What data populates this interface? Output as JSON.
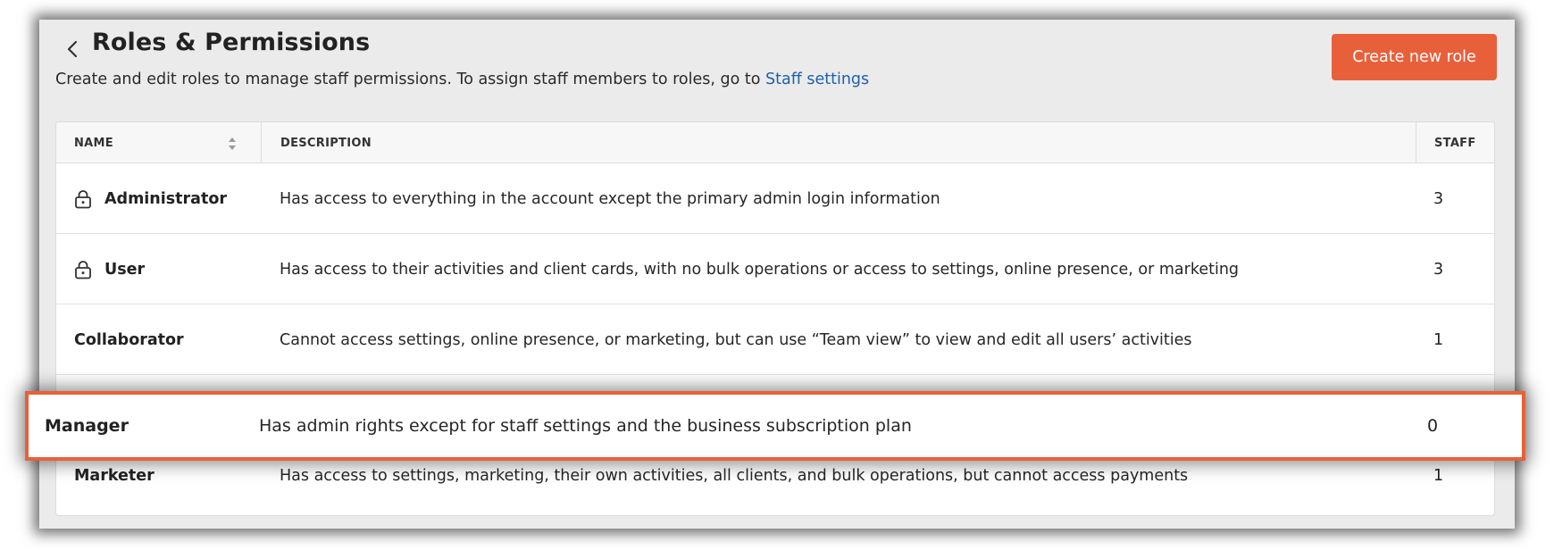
{
  "header": {
    "title": "Roles & Permissions",
    "subtitle": "Create and edit roles to manage staff permissions. To assign staff members to roles, go to",
    "subtitle_link": "Staff settings",
    "create_button": "Create new role"
  },
  "table": {
    "columns": {
      "name": "NAME",
      "description": "DESCRIPTION",
      "staff": "STAFF"
    },
    "rows": [
      {
        "name": "Administrator",
        "locked": true,
        "description": "Has access to everything in the account except the primary admin login information",
        "staff": "3"
      },
      {
        "name": "User",
        "locked": true,
        "description": "Has access to their activities and client cards, with no bulk operations or access to settings, online presence, or marketing",
        "staff": "3"
      },
      {
        "name": "Collaborator",
        "locked": false,
        "description": "Cannot access settings, online presence, or marketing, but can use “Team view” to view and edit all users’ activities",
        "staff": "1"
      },
      {
        "name": "Marketer",
        "locked": false,
        "description": "Has access to settings, marketing, their own activities, all clients, and bulk operations, but cannot access payments",
        "staff": "1"
      }
    ]
  },
  "highlight": {
    "name": "Manager",
    "description": "Has admin rights except for staff settings and the business subscription plan",
    "staff": "0"
  },
  "colors": {
    "accent": "#e8603a",
    "link": "#1f5fa8"
  },
  "icons": [
    "chevron-left-icon",
    "sort-icon",
    "lock-icon"
  ]
}
